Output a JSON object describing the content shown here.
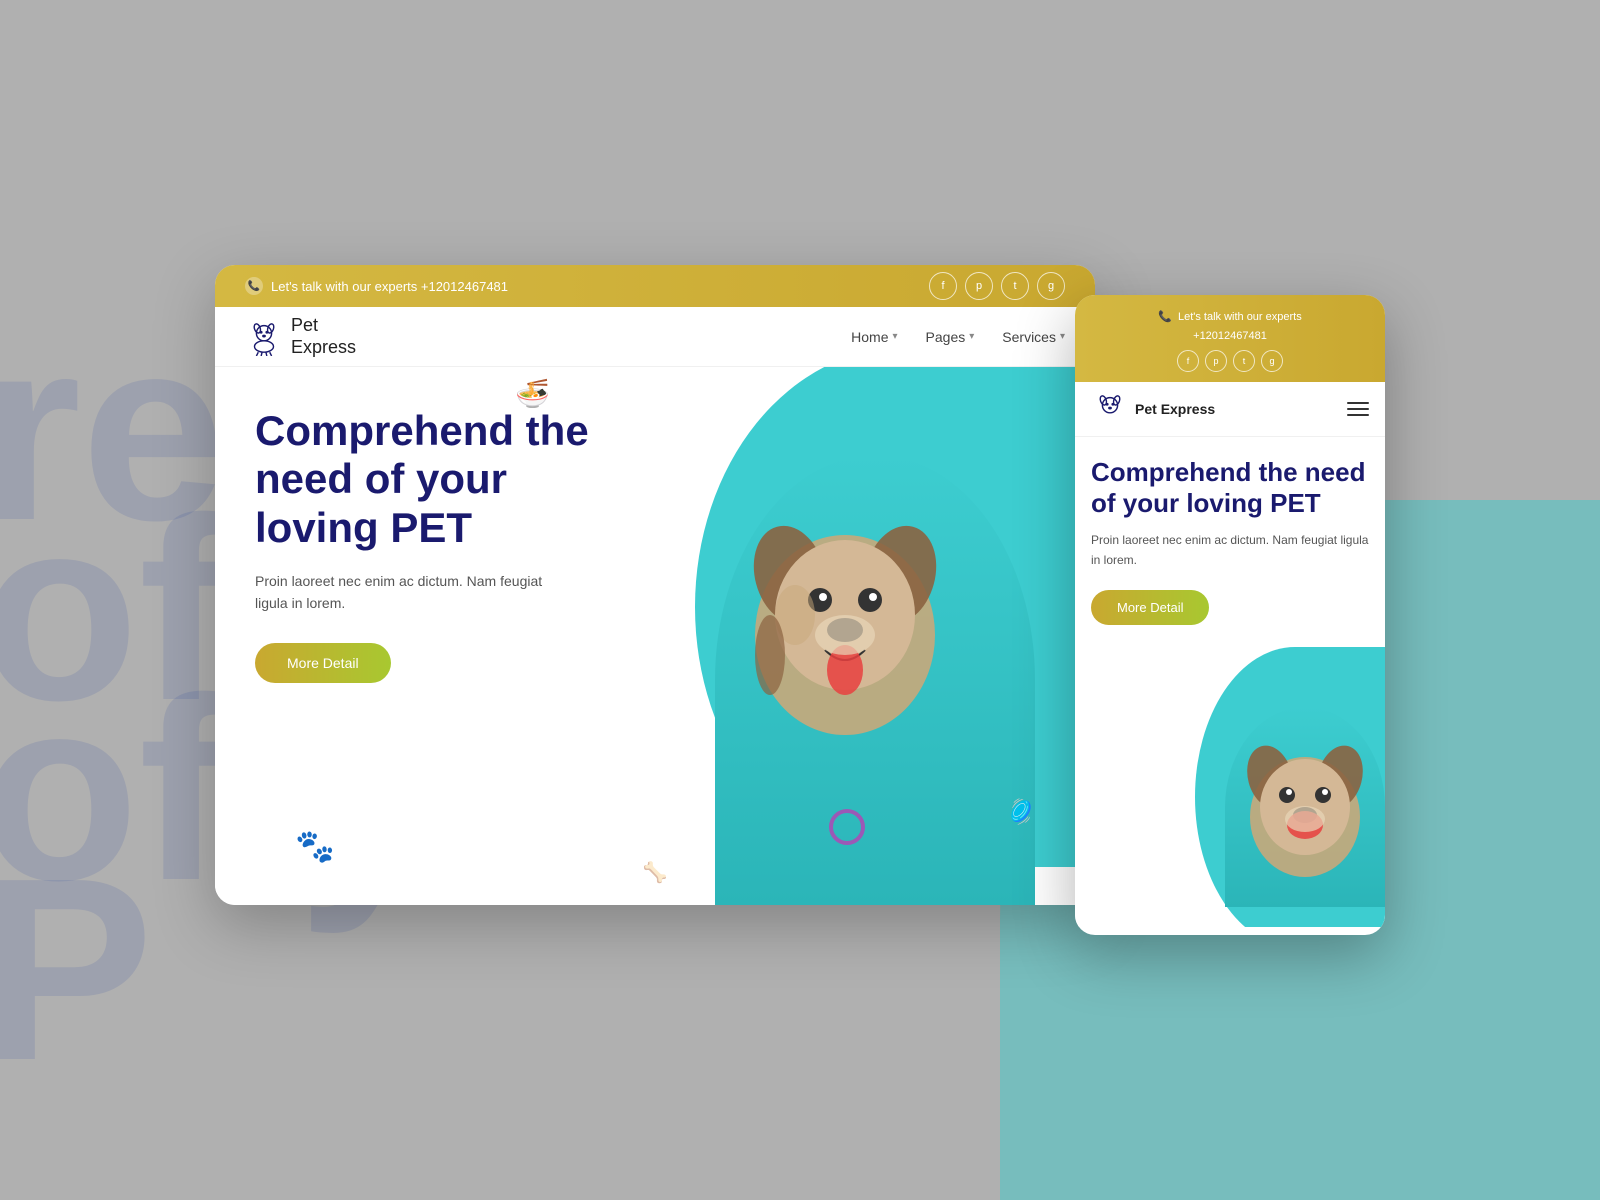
{
  "background": {
    "text_lines": [
      "rel",
      "of y",
      "of y",
      "P"
    ]
  },
  "desktop": {
    "topbar": {
      "phone_text": "Let's talk with our experts +12012467481",
      "social": [
        "f",
        "p",
        "t",
        "g"
      ]
    },
    "nav": {
      "logo_line1": "Pet",
      "logo_line2": "Express",
      "links": [
        {
          "label": "Home",
          "has_dropdown": true
        },
        {
          "label": "Pages",
          "has_dropdown": true
        },
        {
          "label": "Services",
          "has_dropdown": true
        }
      ]
    },
    "hero": {
      "title": "Comprehend the need of your loving PET",
      "description": "Proin laoreet nec enim ac dictum. Nam feugiat ligula in lorem.",
      "button_label": "More Detail"
    }
  },
  "mobile": {
    "topbar": {
      "phone_line1": "Let's talk with our experts",
      "phone_line2": "+12012467481",
      "social": [
        "f",
        "p",
        "t",
        "g"
      ]
    },
    "nav": {
      "logo_line1": "Pet",
      "logo_line2": "Express"
    },
    "hero": {
      "title": "Comprehend the need of your loving PET",
      "description": "Proin laoreet nec enim ac dictum. Nam feugiat ligula in lorem.",
      "button_label": "More Detail"
    }
  },
  "colors": {
    "topbar_gold": "#c9a830",
    "teal": "#3dcdd0",
    "navy": "#1a1a6e",
    "button_gradient_start": "#c9a830",
    "button_gradient_end": "#a8c830"
  }
}
